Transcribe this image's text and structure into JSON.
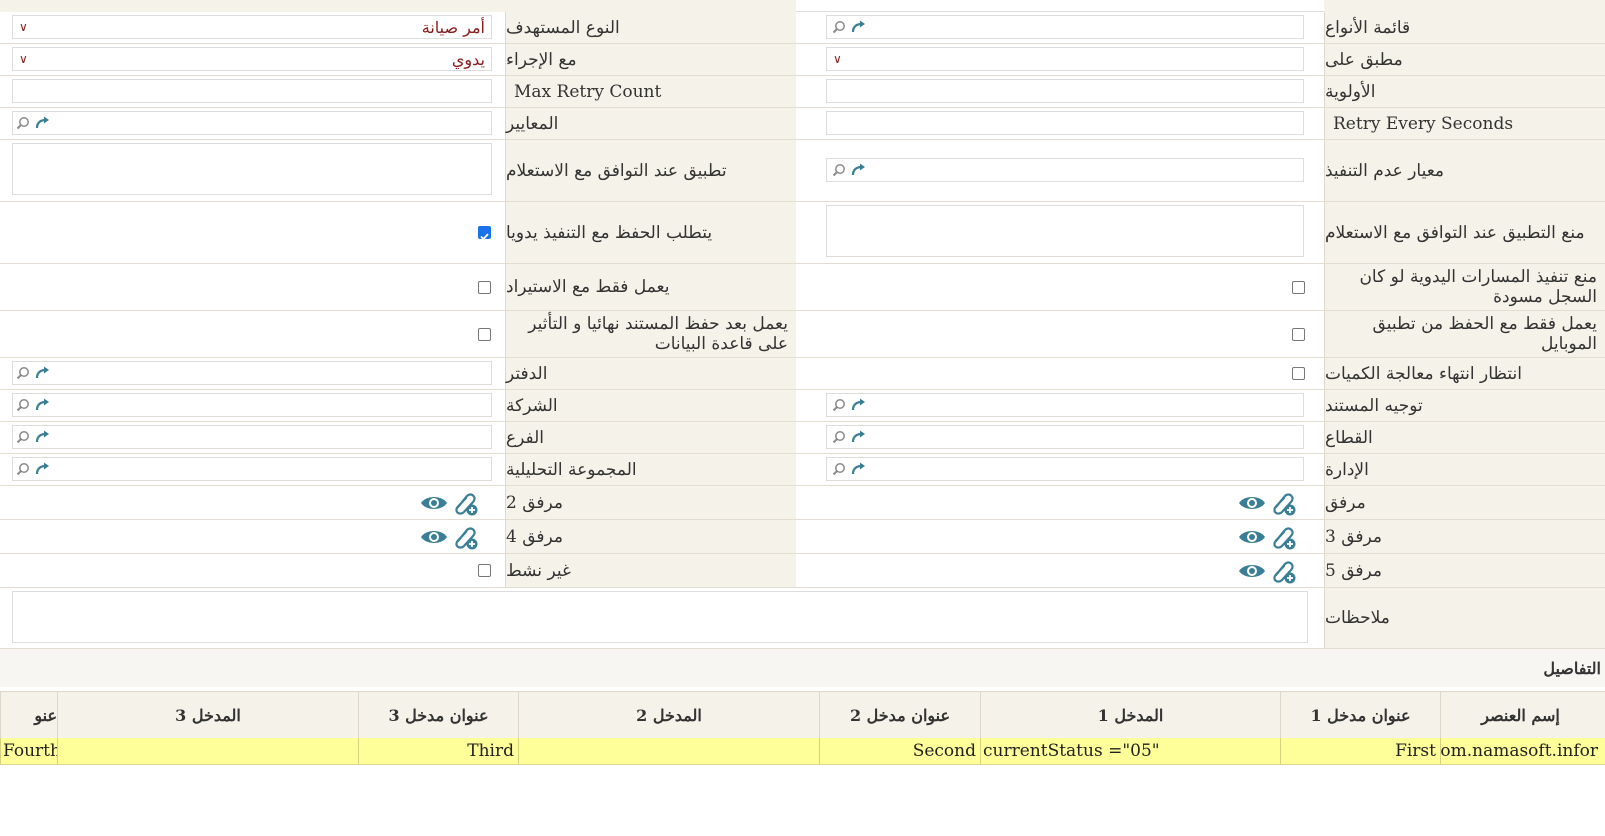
{
  "top_strip_text": "……",
  "form": {
    "rows": [
      {
        "right_label": "قائمة الأنواع",
        "left_label": "النوع المستهدف",
        "left_select": "أمر صيانة"
      },
      {
        "right_label": "مطبق على",
        "left_label": "مع الإجراء",
        "left_select": "يدوي"
      },
      {
        "right_label": "الأولوية",
        "left_label": "Max Retry Count"
      },
      {
        "right_label": "Retry Every Seconds",
        "left_label": "المعايير"
      },
      {
        "right_label": "معيار عدم التنفيذ",
        "left_label": "تطبيق عند التوافق مع الاستعلام"
      },
      {
        "right_label": "منع التطبيق عند التوافق مع الاستعلام",
        "left_label": "يتطلب الحفظ مع التنفيذ يدويا",
        "left_checked": true
      },
      {
        "right_label": "منع تنفيذ المسارات اليدوية لو كان السجل مسودة",
        "left_label": "يعمل فقط مع الاستيراد",
        "right_checked": false,
        "left_checked": false
      },
      {
        "right_label": "يعمل فقط مع الحفظ من تطبيق الموبايل",
        "left_label": "يعمل بعد حفظ المستند نهائيا و التأثير على قاعدة البيانات",
        "right_checked": false,
        "left_checked": false
      },
      {
        "right_label": "انتظار انتهاء معالجة الكميات",
        "left_label": "الدفتر",
        "right_checked": false
      },
      {
        "right_label": "توجيه المستند",
        "left_label": "الشركة"
      },
      {
        "right_label": "القطاع",
        "left_label": "الفرع"
      },
      {
        "right_label": "الإدارة",
        "left_label": "المجموعة التحليلية"
      },
      {
        "right_label": "مرفق",
        "left_label": "مرفق 2"
      },
      {
        "right_label": "مرفق 3",
        "left_label": "مرفق 4"
      },
      {
        "right_label": "مرفق 5",
        "left_label": "غير نشط",
        "left_checked": false
      },
      {
        "right_label": "ملاحظات"
      }
    ]
  },
  "details": {
    "title": "التفاصيل",
    "columns": [
      "إسم العنصر",
      "عنوان مدخل 1",
      "المدخل 1",
      "عنوان مدخل 2",
      "المدخل 2",
      "عنوان مدخل 3",
      "المدخل 3",
      "عنو"
    ],
    "row": [
      "com.namasoft.infor",
      "First",
      "currentStatus =\"05\"",
      "Second",
      "",
      "Third",
      "",
      "Fourth"
    ]
  },
  "colors": {
    "label_bg": "#f5f2ea",
    "highlight_row": "#ffff99",
    "select_text": "#8b1a1a",
    "icon_teal": "#3a7f96"
  }
}
